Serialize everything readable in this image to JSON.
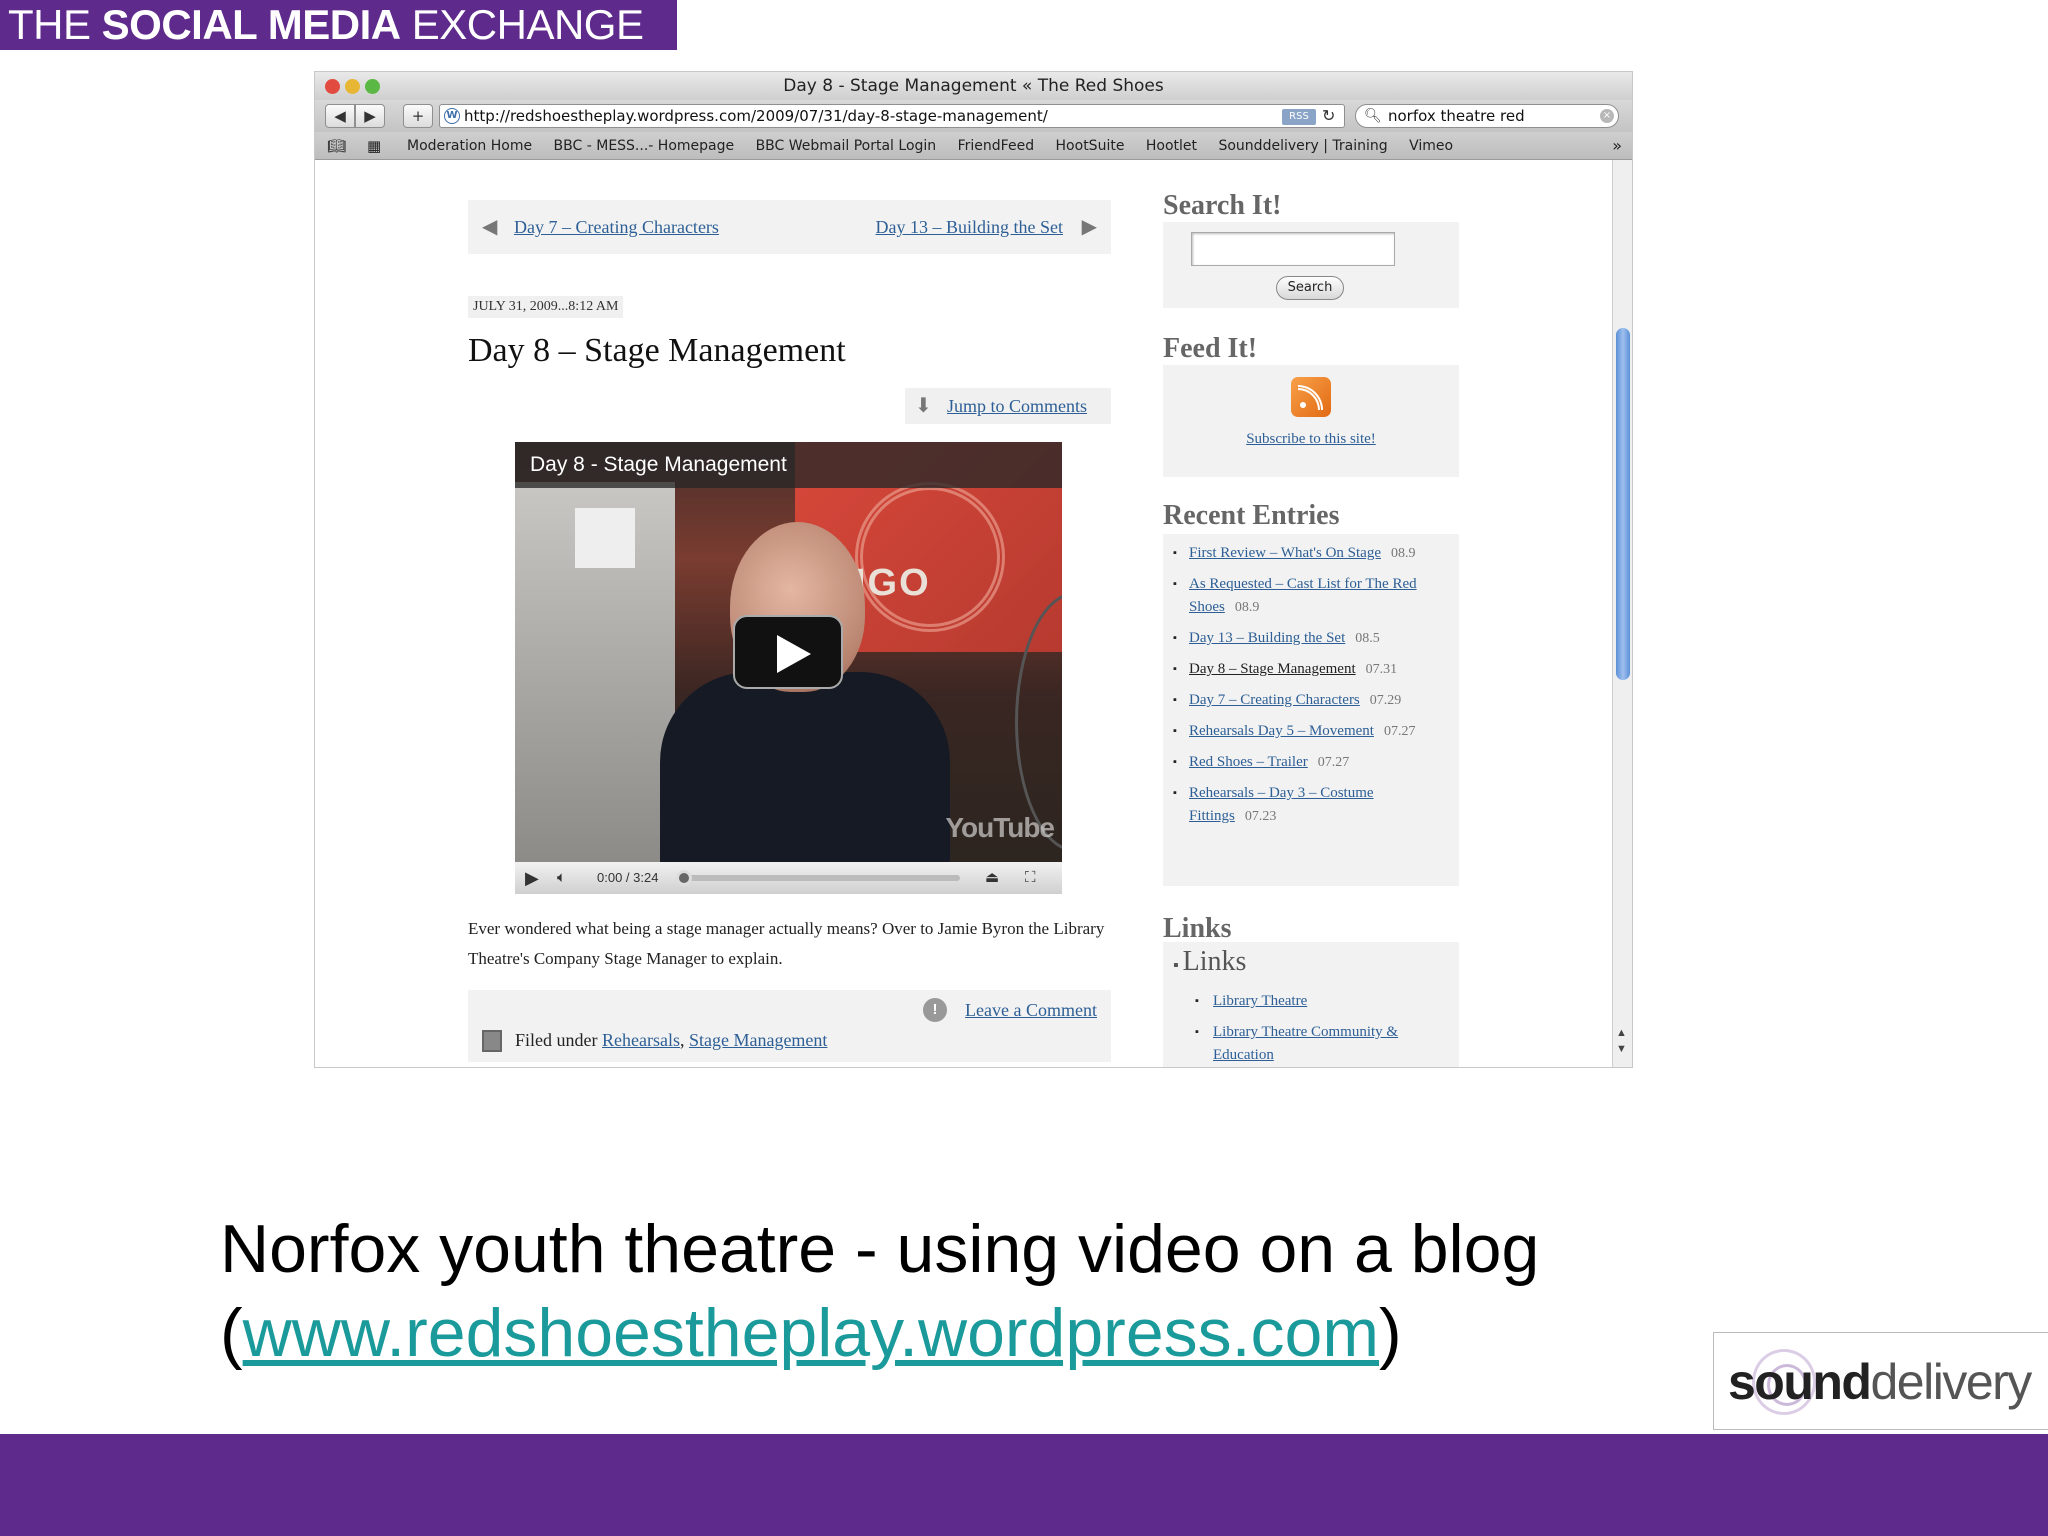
{
  "banner": {
    "bold": "SOCIAL MEDIA",
    "pre": "THE ",
    "post": " EXCHANGE"
  },
  "browser": {
    "window_title": "Day 8 - Stage Management « The Red Shoes",
    "url": "http://redshoestheplay.wordpress.com/2009/07/31/day-8-stage-management/",
    "rss_badge": "RSS",
    "search_value": "norfox theatre red",
    "bookmarks": [
      "Moderation Home",
      "BBC - MESS...- Homepage",
      "BBC Webmail Portal Login",
      "FriendFeed",
      "HootSuite",
      "Hootlet",
      "Sounddelivery | Training",
      "Vimeo"
    ]
  },
  "post": {
    "prev_link": "Day 7 – Creating Characters",
    "next_link": "Day 13 – Building the Set",
    "date": "JULY 31, 2009...8:12 AM",
    "title": "Day 8 – Stage Management",
    "jump_link": "Jump to Comments",
    "video": {
      "title": "Day 8 - Stage Management",
      "time": "0:00 / 3:24",
      "logo": "YouTube",
      "sign": "IGO"
    },
    "excerpt": "Ever wondered what being a stage manager actually means? Over to Jamie Byron the Library Theatre's Company Stage Manager to explain.",
    "leave_comment": "Leave a Comment",
    "filed_under_label": "Filed under ",
    "categories": [
      "Rehearsals",
      "Stage Management"
    ]
  },
  "sidebar": {
    "search_heading": "Search It!",
    "search_button": "Search",
    "feed_heading": "Feed It!",
    "subscribe_link": "Subscribe to this site!",
    "recent_heading": "Recent Entries",
    "recent_entries": [
      {
        "title": "First Review – What's On Stage",
        "date": "08.9"
      },
      {
        "title": "As Requested – Cast List for The Red Shoes",
        "date": "08.9"
      },
      {
        "title": "Day 13 – Building the Set",
        "date": "08.5"
      },
      {
        "title": "Day 8 – Stage Management",
        "date": "07.31"
      },
      {
        "title": "Day 7 – Creating Characters",
        "date": "07.29"
      },
      {
        "title": "Rehearsals Day 5 – Movement",
        "date": "07.27"
      },
      {
        "title": "Red Shoes – Trailer",
        "date": "07.27"
      },
      {
        "title": "Rehearsals – Day 3 – Costume Fittings",
        "date": "07.23"
      }
    ],
    "links_heading": "Links",
    "links_subheading": "Links",
    "links": [
      "Library Theatre",
      "Library Theatre Community & Education"
    ]
  },
  "caption": {
    "line1": "Norfox youth theatre - using video on a blog",
    "open_paren": "(",
    "link": "www.redshoestheplay.wordpress.com",
    "close_paren": ")"
  },
  "logo": {
    "sound": "sound",
    "delivery": "delivery"
  },
  "colors": {
    "brand_purple": "#5e2a8c",
    "link_blue": "#2d5f96",
    "caption_link": "#1a9a9a"
  }
}
